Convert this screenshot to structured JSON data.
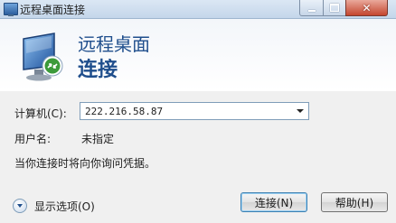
{
  "window": {
    "title": "远程桌面连接"
  },
  "banner": {
    "line1": "远程桌面",
    "line2": "连接"
  },
  "form": {
    "computer_label": "计算机(C):",
    "computer_value": "222.216.58.87",
    "username_label": "用户名:",
    "username_value": "未指定",
    "info_text": "当你连接时将向你询问凭据。"
  },
  "footer": {
    "options_label": "显示选项(O)",
    "connect_label": "连接(N)",
    "help_label": "帮助(H)"
  },
  "colors": {
    "banner_text": "#1f4e8c",
    "title_bar": "#c4d6ea",
    "close_button": "#c4462f"
  }
}
